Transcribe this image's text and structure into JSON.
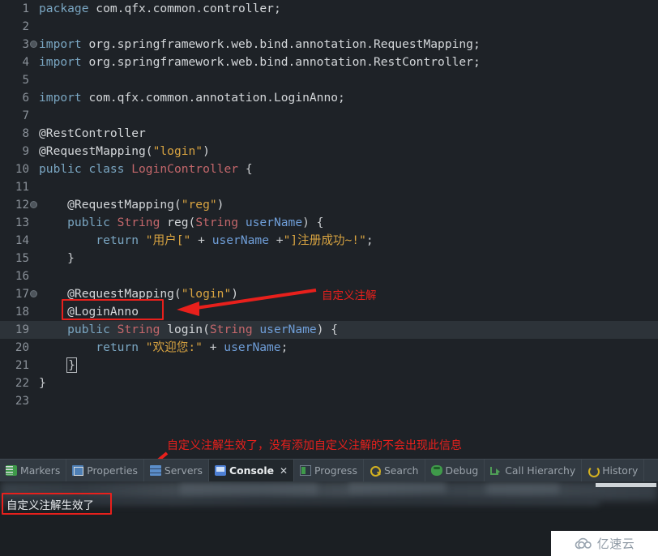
{
  "editor": {
    "language": "java",
    "current_line": 19,
    "lines": [
      {
        "n": "1",
        "fold": false,
        "tokens": [
          {
            "t": "kw",
            "x": "package"
          },
          {
            "t": "plain",
            "x": " com.qfx.common.controller;"
          }
        ]
      },
      {
        "n": "2",
        "fold": false,
        "tokens": []
      },
      {
        "n": "3",
        "fold": true,
        "tokens": [
          {
            "t": "kw",
            "x": "import"
          },
          {
            "t": "plain",
            "x": " org.springframework.web.bind.annotation.RequestMapping;"
          }
        ]
      },
      {
        "n": "4",
        "fold": false,
        "tokens": [
          {
            "t": "kw",
            "x": "import"
          },
          {
            "t": "plain",
            "x": " org.springframework.web.bind.annotation.RestController;"
          }
        ]
      },
      {
        "n": "5",
        "fold": false,
        "tokens": []
      },
      {
        "n": "6",
        "fold": false,
        "tokens": [
          {
            "t": "kw",
            "x": "import"
          },
          {
            "t": "plain",
            "x": " com.qfx.common.annotation.LoginAnno;"
          }
        ]
      },
      {
        "n": "7",
        "fold": false,
        "tokens": []
      },
      {
        "n": "8",
        "fold": false,
        "tokens": [
          {
            "t": "anno",
            "x": "@RestController"
          }
        ]
      },
      {
        "n": "9",
        "fold": false,
        "tokens": [
          {
            "t": "anno",
            "x": "@RequestMapping("
          },
          {
            "t": "str",
            "x": "\"login\""
          },
          {
            "t": "anno",
            "x": ")"
          }
        ]
      },
      {
        "n": "10",
        "fold": false,
        "tokens": [
          {
            "t": "kw",
            "x": "public class "
          },
          {
            "t": "type",
            "x": "LoginController"
          },
          {
            "t": "punc",
            "x": " {"
          }
        ]
      },
      {
        "n": "11",
        "fold": false,
        "tokens": []
      },
      {
        "n": "12",
        "fold": true,
        "tokens": [
          {
            "t": "anno",
            "x": "    @RequestMapping("
          },
          {
            "t": "str",
            "x": "\"reg\""
          },
          {
            "t": "anno",
            "x": ")"
          }
        ]
      },
      {
        "n": "13",
        "fold": false,
        "tokens": [
          {
            "t": "kw",
            "x": "    public "
          },
          {
            "t": "type",
            "x": "String"
          },
          {
            "t": "plain",
            "x": " reg("
          },
          {
            "t": "type",
            "x": "String"
          },
          {
            "t": "var",
            "x": " userName"
          },
          {
            "t": "punc",
            "x": ") {"
          }
        ]
      },
      {
        "n": "14",
        "fold": false,
        "tokens": [
          {
            "t": "kw",
            "x": "        return "
          },
          {
            "t": "str",
            "x": "\"用户[\""
          },
          {
            "t": "op",
            "x": " + "
          },
          {
            "t": "var",
            "x": "userName"
          },
          {
            "t": "op",
            "x": " +"
          },
          {
            "t": "str",
            "x": "\"]注册成功~!\""
          },
          {
            "t": "punc",
            "x": ";"
          }
        ]
      },
      {
        "n": "15",
        "fold": false,
        "tokens": [
          {
            "t": "punc",
            "x": "    }"
          }
        ]
      },
      {
        "n": "16",
        "fold": false,
        "tokens": []
      },
      {
        "n": "17",
        "fold": true,
        "tokens": [
          {
            "t": "anno",
            "x": "    @RequestMapping("
          },
          {
            "t": "str",
            "x": "\"login\""
          },
          {
            "t": "anno",
            "x": ")"
          }
        ]
      },
      {
        "n": "18",
        "fold": false,
        "tokens": [
          {
            "t": "anno",
            "x": "    @LoginAnno"
          }
        ]
      },
      {
        "n": "19",
        "fold": false,
        "hl": true,
        "tokens": [
          {
            "t": "kw",
            "x": "    public "
          },
          {
            "t": "type",
            "x": "String"
          },
          {
            "t": "plain",
            "x": " login("
          },
          {
            "t": "type",
            "x": "String"
          },
          {
            "t": "var",
            "x": " userName"
          },
          {
            "t": "punc",
            "x": ") {"
          }
        ]
      },
      {
        "n": "20",
        "fold": false,
        "tokens": [
          {
            "t": "kw",
            "x": "        return "
          },
          {
            "t": "str",
            "x": "\"欢迎您:\""
          },
          {
            "t": "op",
            "x": " + "
          },
          {
            "t": "var",
            "x": "userName"
          },
          {
            "t": "punc",
            "x": ";"
          }
        ]
      },
      {
        "n": "21",
        "fold": false,
        "brace": "    }",
        "tokens": []
      },
      {
        "n": "22",
        "fold": false,
        "tokens": [
          {
            "t": "punc",
            "x": "}"
          }
        ]
      },
      {
        "n": "23",
        "fold": false,
        "tokens": []
      }
    ]
  },
  "annotations": {
    "accent_color": "#e8201c",
    "label_anno": "自定义注解",
    "label_console": "自定义注解生效了，没有添加自定义注解的不会出现此信息",
    "box_anno_target": "@LoginAnno",
    "box_console_target": "自定义注解生效了"
  },
  "bottom_panel": {
    "tabs": [
      {
        "label": "Markers",
        "icon": "markers-icon",
        "icon_class": "ic-markers",
        "active": false,
        "closable": false
      },
      {
        "label": "Properties",
        "icon": "properties-icon",
        "icon_class": "ic-props",
        "active": false,
        "closable": false
      },
      {
        "label": "Servers",
        "icon": "servers-icon",
        "icon_class": "ic-servers",
        "active": false,
        "closable": false
      },
      {
        "label": "Console",
        "icon": "console-icon",
        "icon_class": "ic-console",
        "active": true,
        "closable": true,
        "close_glyph": "✕"
      },
      {
        "label": "Progress",
        "icon": "progress-icon",
        "icon_class": "ic-progress",
        "active": false,
        "closable": false
      },
      {
        "label": "Search",
        "icon": "search-icon",
        "icon_class": "ic-search",
        "active": false,
        "closable": false
      },
      {
        "label": "Debug",
        "icon": "debug-icon",
        "icon_class": "ic-debug",
        "active": false,
        "closable": false
      },
      {
        "label": "Call Hierarchy",
        "icon": "call-hierarchy-icon",
        "icon_class": "ic-callh",
        "active": false,
        "closable": false
      },
      {
        "label": "History",
        "icon": "history-icon",
        "icon_class": "ic-history",
        "active": false,
        "closable": false
      }
    ],
    "console_output": "自定义注解生效了"
  },
  "watermark": {
    "text": "亿速云",
    "icon": "cloud-icon"
  }
}
